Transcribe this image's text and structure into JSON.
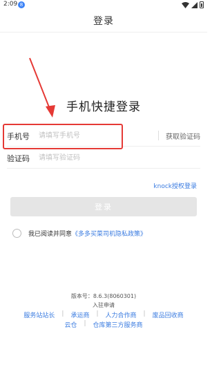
{
  "status_bar": {
    "time": "2:09",
    "notification_badge": "8"
  },
  "nav": {
    "title": "登录"
  },
  "heading": "手机快捷登录",
  "phone": {
    "label": "手机号",
    "placeholder": "请填写手机号",
    "get_code": "获取验证码"
  },
  "code": {
    "label": "验证码",
    "placeholder": "请填写验证码"
  },
  "knock_link": "knock授权登录",
  "login_button": "登录",
  "agreement": {
    "text": "我已阅读并同意",
    "policy": "《多多买菜司机隐私政策》"
  },
  "footer": {
    "version": "版本号：8.6.3(8060301)",
    "apply": "入驻申请",
    "links_row1": [
      "服务站站长",
      "承运商",
      "人力合作商",
      "废品回收商"
    ],
    "links_row2": [
      "云仓",
      "仓库第三方服务商"
    ]
  },
  "colors": {
    "accent": "#3a7be0",
    "highlight": "#e53935",
    "button_disabled": "#e5e5e5"
  }
}
